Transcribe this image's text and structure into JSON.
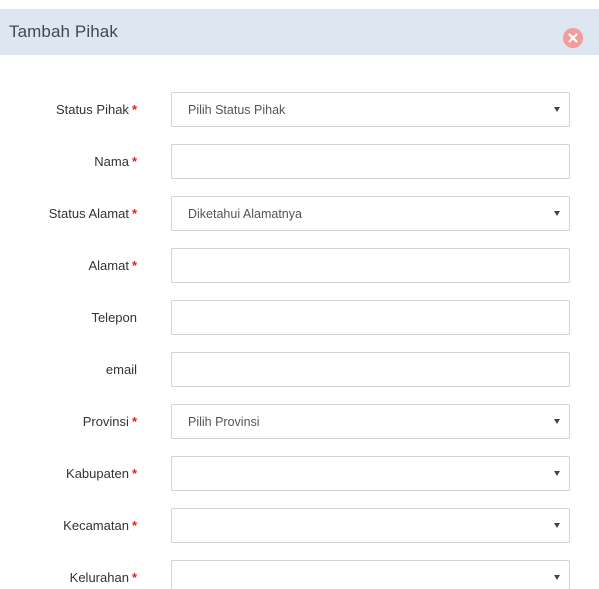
{
  "dialog": {
    "title": "Tambah Pihak",
    "close_icon": "close-icon",
    "required_marker": "*"
  },
  "fields": {
    "status_pihak": {
      "label": "Status Pihak",
      "required": true,
      "type": "select",
      "value": "Pilih Status Pihak"
    },
    "nama": {
      "label": "Nama",
      "required": true,
      "type": "text",
      "value": ""
    },
    "status_alamat": {
      "label": "Status Alamat",
      "required": true,
      "type": "select",
      "value": "Diketahui Alamatnya"
    },
    "alamat": {
      "label": "Alamat",
      "required": true,
      "type": "text",
      "value": ""
    },
    "telepon": {
      "label": "Telepon",
      "required": false,
      "type": "text",
      "value": ""
    },
    "email": {
      "label": "email",
      "required": false,
      "type": "text",
      "value": ""
    },
    "provinsi": {
      "label": "Provinsi",
      "required": true,
      "type": "select",
      "value": "Pilih Provinsi"
    },
    "kabupaten": {
      "label": "Kabupaten",
      "required": true,
      "type": "select",
      "value": ""
    },
    "kecamatan": {
      "label": "Kecamatan",
      "required": true,
      "type": "select",
      "value": ""
    },
    "kelurahan": {
      "label": "Kelurahan",
      "required": true,
      "type": "select",
      "value": ""
    }
  },
  "colors": {
    "header_bg": "#dde6f1",
    "close_button": "#f29c9c",
    "required_marker": "#d9232e",
    "field_border": "#cfd4da"
  }
}
